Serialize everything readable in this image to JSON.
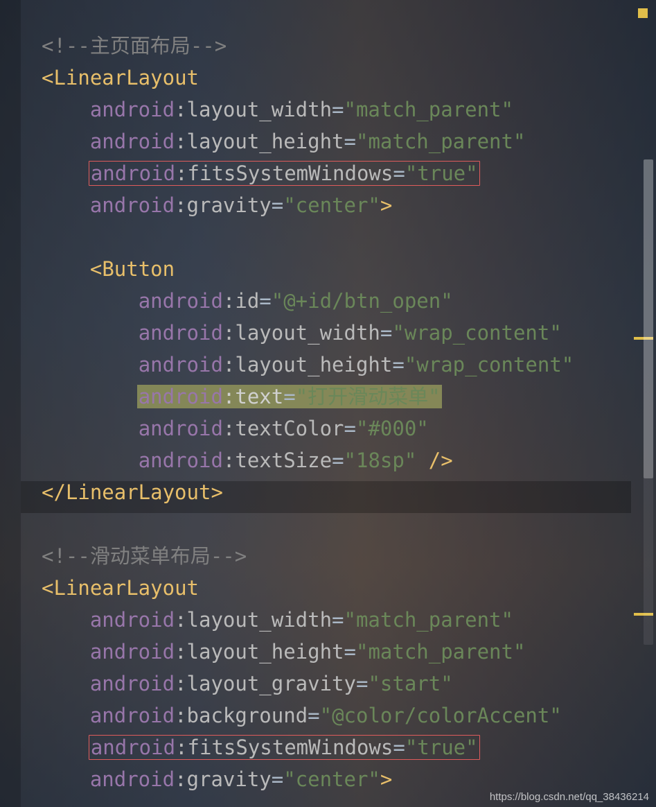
{
  "punct": {
    "lt": "<",
    "gt": ">",
    "slashgt": "/>",
    "endgt": ">",
    "close_prefix": "</",
    "eq": "=",
    "colon": ":"
  },
  "comments": {
    "main": "<!--主页面布局-->",
    "drawer": "<!--滑动菜单布局-->"
  },
  "l1": {
    "tag": "LinearLayout",
    "a1": {
      "ns": "android",
      "name": "layout_width",
      "val": "\"match_parent\""
    },
    "a2": {
      "ns": "android",
      "name": "layout_height",
      "val": "\"match_parent\""
    },
    "a3": {
      "ns": "android",
      "name": "fitsSystemWindows",
      "val": "\"true\""
    },
    "a4": {
      "ns": "android",
      "name": "gravity",
      "val": "\"center\""
    }
  },
  "btn": {
    "tag": "Button",
    "a1": {
      "ns": "android",
      "name": "id",
      "val": "\"@+id/btn_open\""
    },
    "a2": {
      "ns": "android",
      "name": "layout_width",
      "val": "\"wrap_content\""
    },
    "a3": {
      "ns": "android",
      "name": "layout_height",
      "val": "\"wrap_content\""
    },
    "a4": {
      "ns": "android",
      "name": "text",
      "val": "\"打开滑动菜单\""
    },
    "a5": {
      "ns": "android",
      "name": "textColor",
      "val": "\"#000\""
    },
    "a6": {
      "ns": "android",
      "name": "textSize",
      "val": "\"18sp\""
    }
  },
  "l2": {
    "tag": "LinearLayout",
    "a1": {
      "ns": "android",
      "name": "layout_width",
      "val": "\"match_parent\""
    },
    "a2": {
      "ns": "android",
      "name": "layout_height",
      "val": "\"match_parent\""
    },
    "a3": {
      "ns": "android",
      "name": "layout_gravity",
      "val": "\"start\""
    },
    "a4": {
      "ns": "android",
      "name": "background",
      "val": "\"@color/colorAccent\""
    },
    "a5": {
      "ns": "android",
      "name": "fitsSystemWindows",
      "val": "\"true\""
    },
    "a6": {
      "ns": "android",
      "name": "gravity",
      "val": "\"center\""
    }
  },
  "watermark": "https://blog.csdn.net/qq_38436214"
}
